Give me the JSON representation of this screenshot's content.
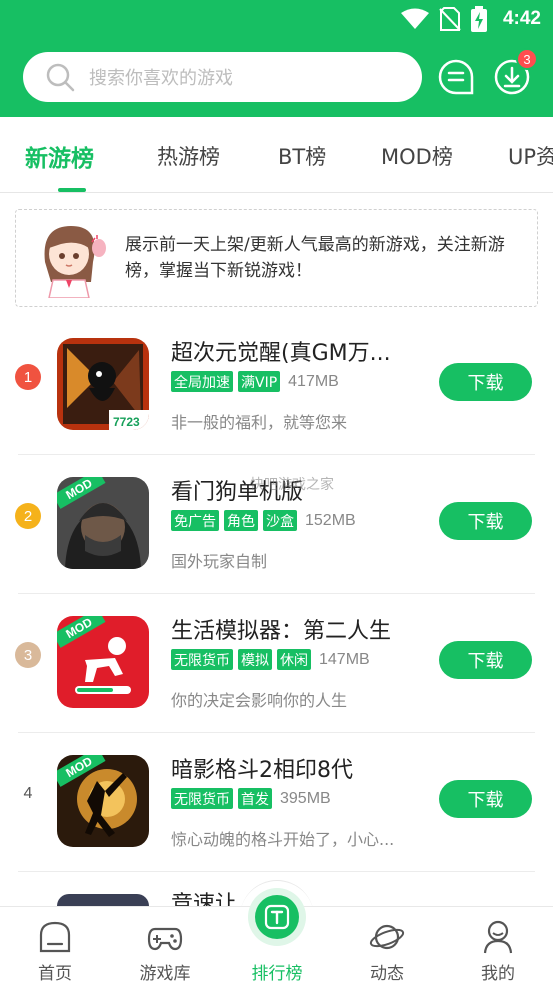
{
  "status_bar": {
    "time": "4:42"
  },
  "search": {
    "placeholder": "搜索你喜欢的游戏"
  },
  "download_badge": "3",
  "tabs": [
    {
      "label": "新游榜",
      "active": true
    },
    {
      "label": "热游榜",
      "active": false
    },
    {
      "label": "BT榜",
      "active": false
    },
    {
      "label": "MOD榜",
      "active": false
    },
    {
      "label": "UP资",
      "active": false
    }
  ],
  "notice": {
    "text": "展示前一天上架/更新人气最高的新游戏，关注新游榜，掌握当下新锐游戏！"
  },
  "games": [
    {
      "rank": "1",
      "rank_color": "#f05340",
      "title": "超次元觉醒(真GM万...",
      "tags": [
        "全局加速",
        "满VIP"
      ],
      "size": "417MB",
      "desc": "非一般的福利，就等您来",
      "download_label": "下载",
      "icon_badge": "7723"
    },
    {
      "rank": "2",
      "rank_color": "#f5b21b",
      "title": "看门狗单机版",
      "tags": [
        "免广告",
        "角色",
        "沙盒"
      ],
      "size": "152MB",
      "desc": "国外玩家自制",
      "download_label": "下载",
      "icon_badge": "MOD"
    },
    {
      "rank": "3",
      "rank_color": "#d9b99a",
      "title": "生活模拟器：第二人生",
      "tags": [
        "无限货币",
        "模拟",
        "休闲"
      ],
      "size": "147MB",
      "desc": "你的决定会影响你的人生",
      "download_label": "下载",
      "icon_badge": "MOD"
    },
    {
      "rank": "4",
      "rank_color": "",
      "title": "暗影格斗2相印8代",
      "tags": [
        "无限货币",
        "首发"
      ],
      "size": "395MB",
      "desc": "惊心动魄的格斗开始了，小心...",
      "download_label": "下载",
      "icon_badge": "MOD"
    },
    {
      "rank": "",
      "rank_color": "",
      "title": "竞速让",
      "tags": [],
      "size": "",
      "desc": "",
      "download_label": "",
      "icon_badge": ""
    }
  ],
  "watermark": "快吧游戏之家",
  "bottom_nav": [
    {
      "label": "首页",
      "icon": "home-icon",
      "active": false
    },
    {
      "label": "游戏库",
      "icon": "gamepad-icon",
      "active": false
    },
    {
      "label": "排行榜",
      "icon": "ranking-icon",
      "active": true
    },
    {
      "label": "动态",
      "icon": "planet-icon",
      "active": false
    },
    {
      "label": "我的",
      "icon": "user-icon",
      "active": false
    }
  ],
  "colors": {
    "brand": "#17bf63",
    "badge": "#ff4d4f"
  }
}
